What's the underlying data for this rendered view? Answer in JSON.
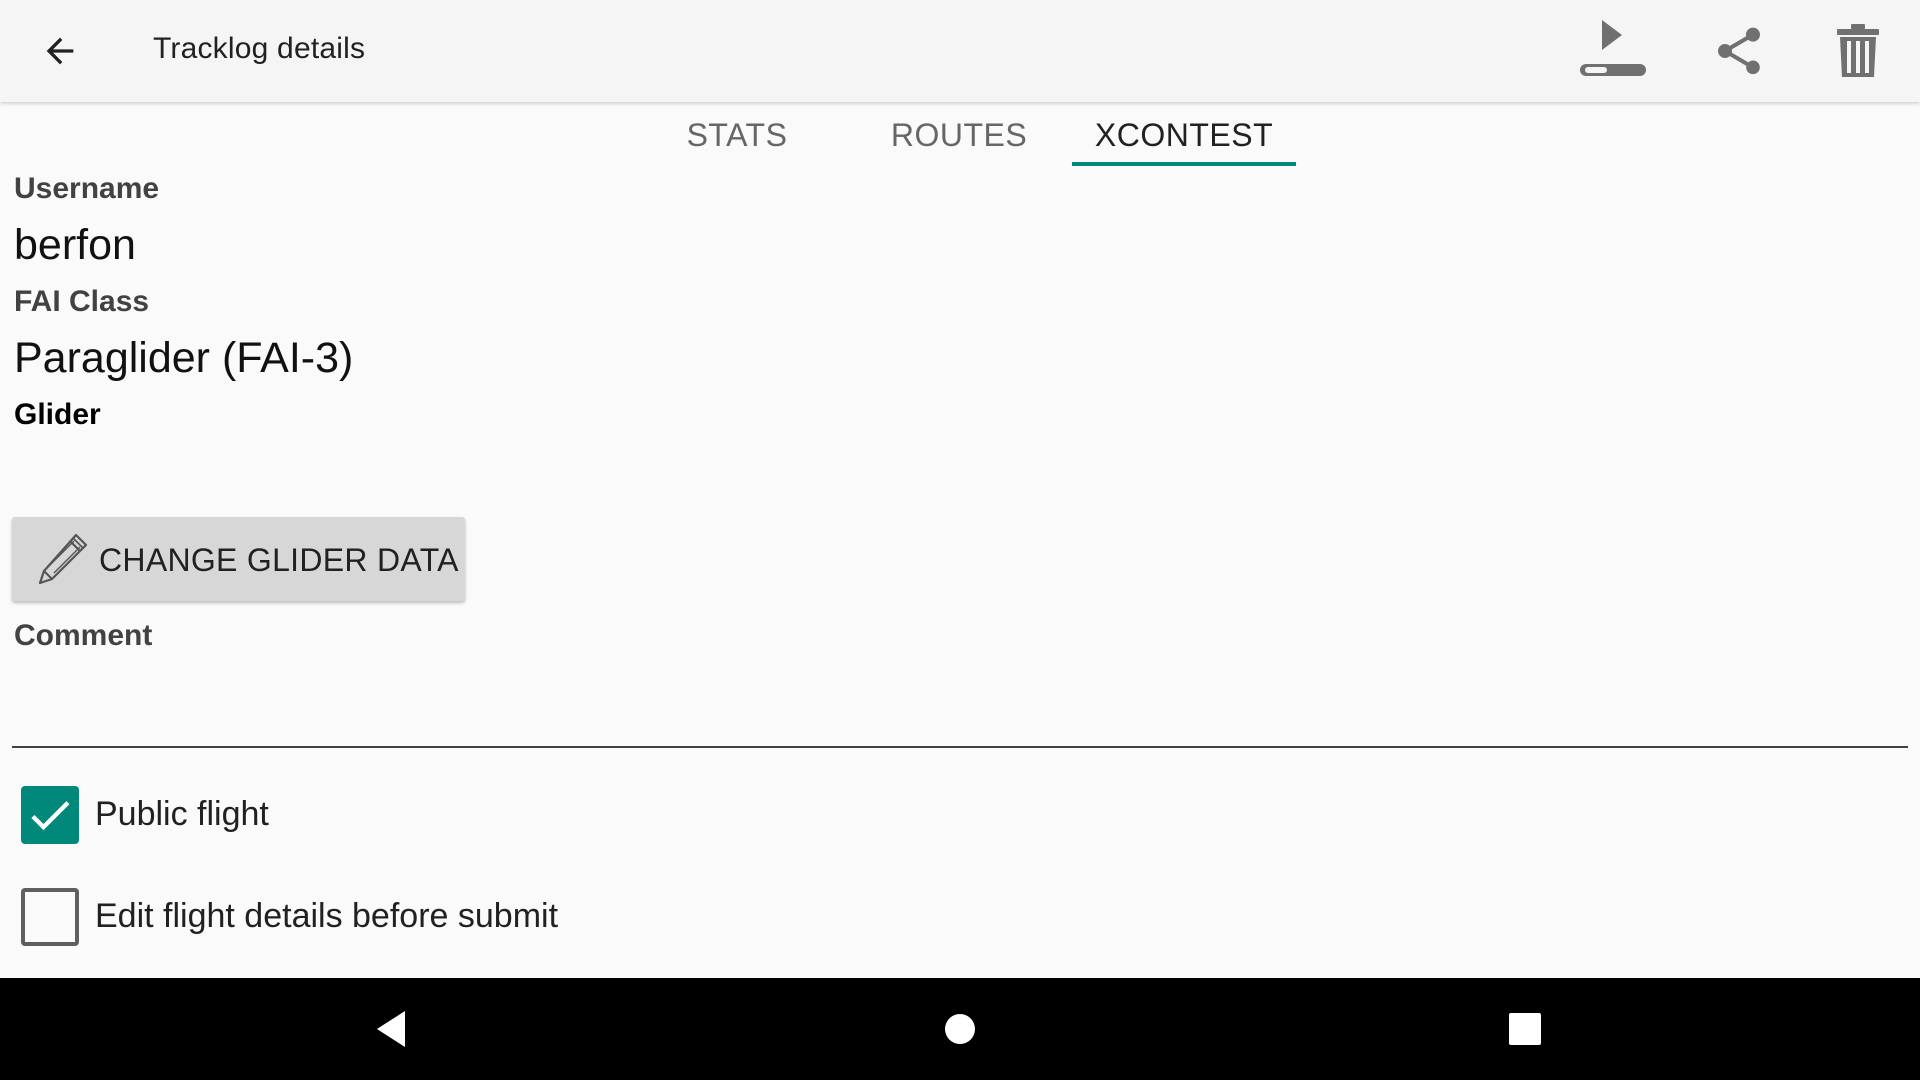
{
  "appbar": {
    "title": "Tracklog details",
    "back_icon": "arrow-back-icon",
    "actions": [
      {
        "name": "play-export-icon"
      },
      {
        "name": "share-icon"
      },
      {
        "name": "trash-icon"
      }
    ]
  },
  "tabs": [
    {
      "label": "STATS",
      "active": false
    },
    {
      "label": "ROUTES",
      "active": false
    },
    {
      "label": "XCONTEST",
      "active": true
    }
  ],
  "details": {
    "username_label": "Username",
    "username_value": "berfon",
    "fai_class_label": "FAI Class",
    "fai_class_value": "Paraglider (FAI-3)",
    "glider_label": "Glider",
    "glider_value": ""
  },
  "change_glider_button": {
    "label": "CHANGE GLIDER DATA",
    "icon": "pencil-icon"
  },
  "comment": {
    "label": "Comment",
    "value": ""
  },
  "checkboxes": {
    "public_flight": {
      "label": "Public flight",
      "checked": true
    },
    "edit_before_submit": {
      "label": "Edit flight details before submit",
      "checked": false
    }
  },
  "colors": {
    "accent": "#00897b",
    "appbar_bg": "#f5f5f5",
    "page_bg": "#fafafa",
    "navbar_bg": "#000000"
  },
  "navbar": {
    "items": [
      {
        "name": "nav-back-icon"
      },
      {
        "name": "nav-home-icon"
      },
      {
        "name": "nav-recents-icon"
      }
    ]
  }
}
